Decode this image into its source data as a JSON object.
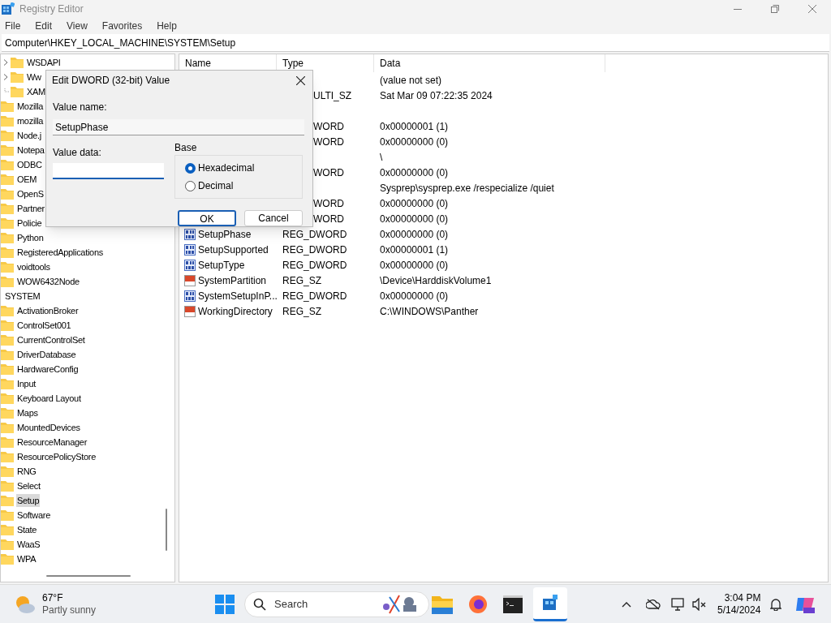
{
  "window": {
    "title": "Registry Editor"
  },
  "menu": [
    "File",
    "Edit",
    "View",
    "Favorites",
    "Help"
  ],
  "address": "Computer\\HKEY_LOCAL_MACHINE\\SYSTEM\\Setup",
  "tree": [
    {
      "label": "WSDAPI",
      "kind": "nested",
      "expandable": true,
      "selected": false
    },
    {
      "label": "Ww",
      "kind": "nested",
      "expandable": true,
      "selected": false
    },
    {
      "label": "XAM",
      "kind": "nested",
      "expandable": false,
      "selected": false
    },
    {
      "label": "Mozilla",
      "kind": "folder",
      "selected": false
    },
    {
      "label": "mozilla",
      "kind": "folder",
      "selected": false
    },
    {
      "label": "Node.j",
      "kind": "folder",
      "selected": false
    },
    {
      "label": "Notepa",
      "kind": "folder",
      "selected": false
    },
    {
      "label": "ODBC",
      "kind": "folder",
      "selected": false
    },
    {
      "label": "OEM",
      "kind": "folder",
      "selected": false
    },
    {
      "label": "OpenS",
      "kind": "folder",
      "selected": false
    },
    {
      "label": "Partner",
      "kind": "folder",
      "selected": false
    },
    {
      "label": "Policie",
      "kind": "folder",
      "selected": false
    },
    {
      "label": "Python",
      "kind": "folder",
      "selected": false
    },
    {
      "label": "RegisteredApplications",
      "kind": "folder",
      "selected": false
    },
    {
      "label": "voidtools",
      "kind": "folder",
      "selected": false
    },
    {
      "label": "WOW6432Node",
      "kind": "folder",
      "selected": false
    },
    {
      "label": "SYSTEM",
      "kind": "hive",
      "selected": false
    },
    {
      "label": "ActivationBroker",
      "kind": "folder",
      "selected": false
    },
    {
      "label": "ControlSet001",
      "kind": "folder",
      "selected": false
    },
    {
      "label": "CurrentControlSet",
      "kind": "folder",
      "selected": false
    },
    {
      "label": "DriverDatabase",
      "kind": "folder",
      "selected": false
    },
    {
      "label": "HardwareConfig",
      "kind": "folder",
      "selected": false
    },
    {
      "label": "Input",
      "kind": "folder",
      "selected": false
    },
    {
      "label": "Keyboard Layout",
      "kind": "folder",
      "selected": false
    },
    {
      "label": "Maps",
      "kind": "folder",
      "selected": false
    },
    {
      "label": "MountedDevices",
      "kind": "folder",
      "selected": false
    },
    {
      "label": "ResourceManager",
      "kind": "folder",
      "selected": false
    },
    {
      "label": "ResourcePolicyStore",
      "kind": "folder",
      "selected": false
    },
    {
      "label": "RNG",
      "kind": "folder",
      "selected": false
    },
    {
      "label": "Select",
      "kind": "folder",
      "selected": false
    },
    {
      "label": "Setup",
      "kind": "folder",
      "selected": true
    },
    {
      "label": "Software",
      "kind": "folder",
      "selected": false
    },
    {
      "label": "State",
      "kind": "folder",
      "selected": false
    },
    {
      "label": "WaaS",
      "kind": "folder",
      "selected": false
    },
    {
      "label": "WPA",
      "kind": "folder",
      "selected": false
    }
  ],
  "columns": [
    "Name",
    "Type",
    "Data"
  ],
  "rows": [
    {
      "kind": "covered",
      "data": "(value not set)"
    },
    {
      "kind": "covered",
      "type": "ULTI_SZ",
      "data": "Sat Mar 09 07:22:35 2024"
    },
    {
      "kind": "covered"
    },
    {
      "kind": "covered",
      "type": "WORD",
      "data": "0x00000001 (1)"
    },
    {
      "kind": "covered",
      "type": "WORD",
      "data": "0x00000000 (0)"
    },
    {
      "kind": "covered",
      "data": "\\"
    },
    {
      "kind": "covered",
      "type": "WORD",
      "data": "0x00000000 (0)"
    },
    {
      "kind": "covered",
      "data": "Sysprep\\sysprep.exe /respecialize /quiet"
    },
    {
      "kind": "covered",
      "type": "WORD",
      "data": "0x00000000 (0)"
    },
    {
      "kind": "covered",
      "type": "WORD",
      "data": "0x00000000 (0)"
    },
    {
      "kind": "dword",
      "name": "SetupPhase",
      "type": "REG_DWORD",
      "data": "0x00000000 (0)"
    },
    {
      "kind": "dword",
      "name": "SetupSupported",
      "type": "REG_DWORD",
      "data": "0x00000001 (1)"
    },
    {
      "kind": "dword",
      "name": "SetupType",
      "type": "REG_DWORD",
      "data": "0x00000000 (0)"
    },
    {
      "kind": "string",
      "name": "SystemPartition",
      "type": "REG_SZ",
      "data": "\\Device\\HarddiskVolume1"
    },
    {
      "kind": "dword",
      "name": "SystemSetupInP...",
      "type": "REG_DWORD",
      "data": "0x00000000 (0)"
    },
    {
      "kind": "string",
      "name": "WorkingDirectory",
      "type": "REG_SZ",
      "data": "C:\\WINDOWS\\Panther"
    }
  ],
  "dialog": {
    "title": "Edit DWORD (32-bit) Value",
    "name_label": "Value name:",
    "name_value": "SetupPhase",
    "data_label": "Value data:",
    "base_label": "Base",
    "bases": [
      {
        "label": "Hexadecimal",
        "selected": true
      },
      {
        "label": "Decimal",
        "selected": false
      }
    ],
    "ok": "OK",
    "cancel": "Cancel"
  },
  "taskbar": {
    "temperature": "67°F",
    "weather": "Partly sunny",
    "search": "Search",
    "time": "3:04 PM",
    "date": "5/14/2024"
  }
}
